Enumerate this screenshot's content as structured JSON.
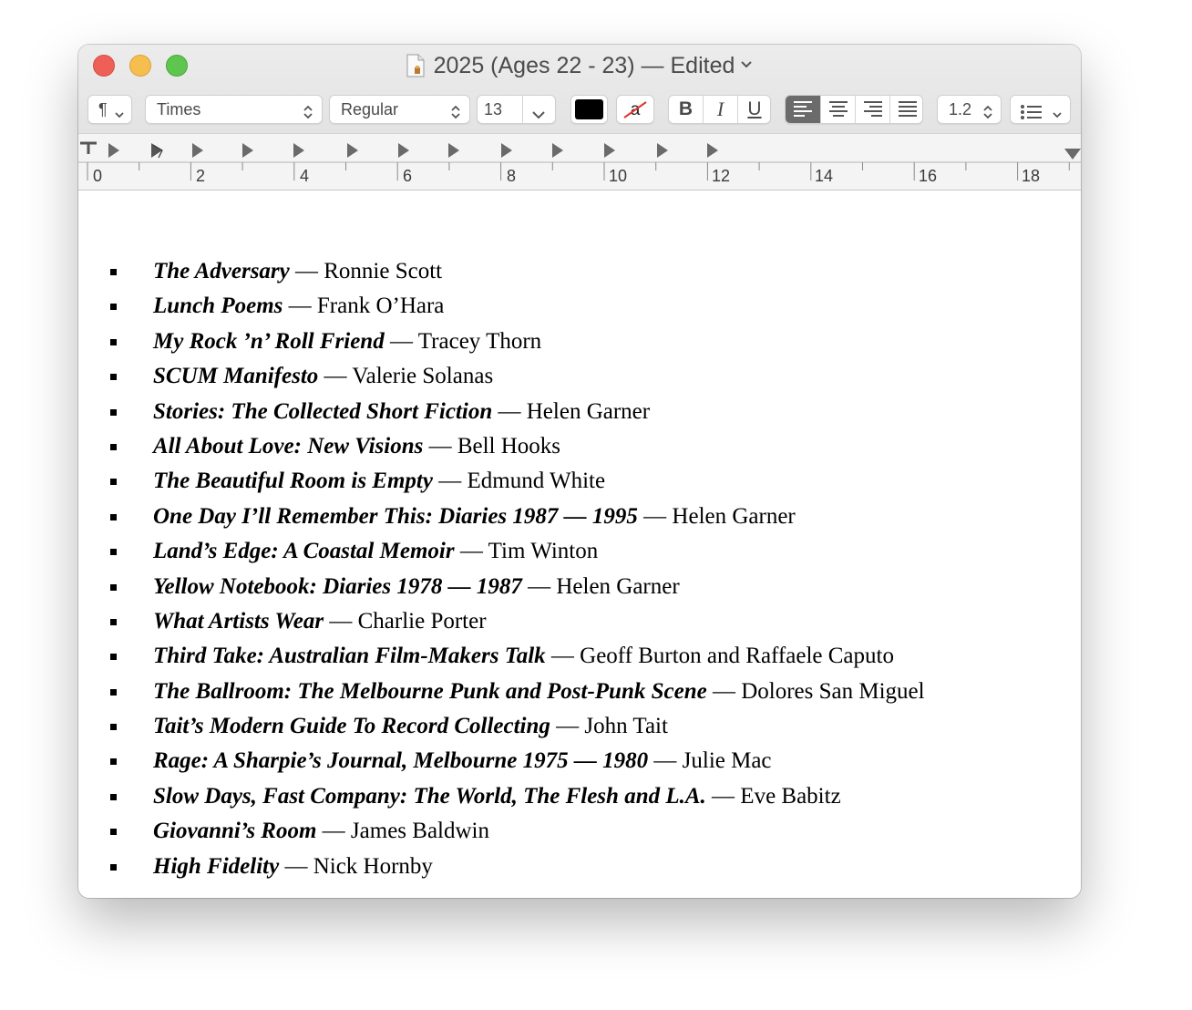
{
  "window": {
    "title": "2025 (Ages 22 - 23) — Edited"
  },
  "toolbar": {
    "paragraph_styles_icon": "¶",
    "font_family": "Times",
    "font_style": "Regular",
    "font_size": "13",
    "text_color": "#000000",
    "line_spacing": "1.2",
    "bold_label": "B",
    "italic_label": "I",
    "underline_label": "U",
    "alignment_selected": "left",
    "icons": [
      "paragraph-icon",
      "chevron-down-icon",
      "stepper-icon",
      "highlight-none-icon",
      "align-left-icon",
      "align-center-icon",
      "align-right-icon",
      "justify-icon",
      "list-bullets-icon"
    ]
  },
  "ruler": {
    "numbers": [
      "0",
      "2",
      "4",
      "6",
      "8",
      "10",
      "12",
      "14",
      "16",
      "18"
    ]
  },
  "document": {
    "items": [
      {
        "title": "The Adversary",
        "author": "Ronnie Scott"
      },
      {
        "title": "Lunch Poems",
        "author": "Frank O’Hara"
      },
      {
        "title": "My Rock ’n’ Roll Friend",
        "author": "Tracey Thorn"
      },
      {
        "title": "SCUM Manifesto",
        "author": "Valerie Solanas"
      },
      {
        "title": "Stories: The Collected Short Fiction",
        "author": "Helen Garner"
      },
      {
        "title": "All About Love: New Visions",
        "author": "Bell Hooks"
      },
      {
        "title": "The Beautiful Room is Empty",
        "author": "Edmund White"
      },
      {
        "title": "One Day I’ll Remember This: Diaries 1987 — 1995",
        "author": "Helen Garner"
      },
      {
        "title": "Land’s Edge: A Coastal Memoir",
        "author": "Tim Winton"
      },
      {
        "title": "Yellow Notebook: Diaries 1978 — 1987",
        "author": "Helen Garner"
      },
      {
        "title": "What Artists Wear",
        "author": "Charlie Porter"
      },
      {
        "title": "Third Take: Australian Film-Makers Talk",
        "author": "Geoff Burton and Raffaele Caputo"
      },
      {
        "title": "The Ballroom: The Melbourne Punk and Post-Punk Scene",
        "author": "Dolores San Miguel"
      },
      {
        "title": "Tait’s Modern Guide To Record Collecting",
        "author": "John Tait"
      },
      {
        "title": "Rage: A Sharpie’s Journal, Melbourne 1975 — 1980",
        "author": "Julie Mac"
      },
      {
        "title": "Slow Days, Fast Company: The World, The Flesh and L.A.",
        "author": "Eve Babitz"
      },
      {
        "title": "Giovanni’s Room",
        "author": "James Baldwin"
      },
      {
        "title": "High Fidelity",
        "author": "Nick Hornby"
      }
    ]
  }
}
